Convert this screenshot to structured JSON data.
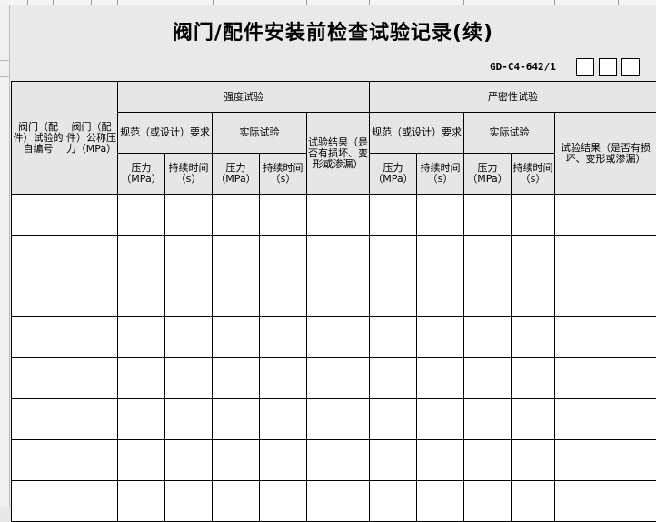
{
  "title": "阀门/配件安装前检查试验记录(续)",
  "form_code": "GD-C4-642/1",
  "table": {
    "col_valve_no": "阀门（配件）试验的自编号",
    "col_nominal_pressure": "阀门（配件）公称压力（MPa）",
    "group_strength": "强度试验",
    "group_tightness": "严密性试验",
    "spec_requirement": "规范（或设计）要求",
    "actual_test": "实际试验",
    "result_strength": "试验结果（是否有损坏、变形或渗漏）",
    "result_tightness": "试验结果（是否有损坏、变形或渗漏）",
    "pressure": "压力（MPa）",
    "duration": "持续时间（s）"
  },
  "rows": [
    [
      "",
      "",
      "",
      "",
      "",
      "",
      "",
      "",
      "",
      "",
      "",
      ""
    ],
    [
      "",
      "",
      "",
      "",
      "",
      "",
      "",
      "",
      "",
      "",
      "",
      ""
    ],
    [
      "",
      "",
      "",
      "",
      "",
      "",
      "",
      "",
      "",
      "",
      "",
      ""
    ],
    [
      "",
      "",
      "",
      "",
      "",
      "",
      "",
      "",
      "",
      "",
      "",
      ""
    ],
    [
      "",
      "",
      "",
      "",
      "",
      "",
      "",
      "",
      "",
      "",
      "",
      ""
    ],
    [
      "",
      "",
      "",
      "",
      "",
      "",
      "",
      "",
      "",
      "",
      "",
      ""
    ],
    [
      "",
      "",
      "",
      "",
      "",
      "",
      "",
      "",
      "",
      "",
      "",
      ""
    ],
    [
      "",
      "",
      "",
      "",
      "",
      "",
      "",
      "",
      "",
      "",
      "",
      ""
    ]
  ]
}
